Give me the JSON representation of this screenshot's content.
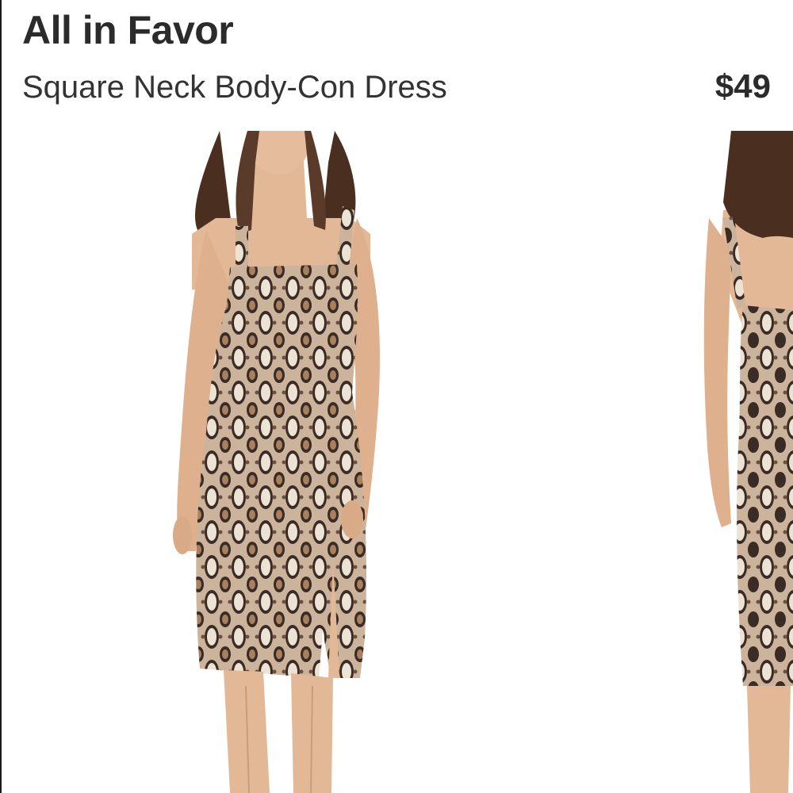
{
  "listing": {
    "brand": "All in Favor",
    "title": "Square Neck Body-Con Dress",
    "price": "$49"
  },
  "gallery": {
    "images": [
      {
        "name": "front-view"
      },
      {
        "name": "back-view"
      }
    ]
  },
  "colors": {
    "text": "#2b2b2b",
    "background": "#ffffff",
    "skin": "#e2b896",
    "hair": "#4a2e20",
    "print_light": "#e8dccb",
    "print_mid": "#b8987a",
    "print_dark": "#3a2c25"
  }
}
